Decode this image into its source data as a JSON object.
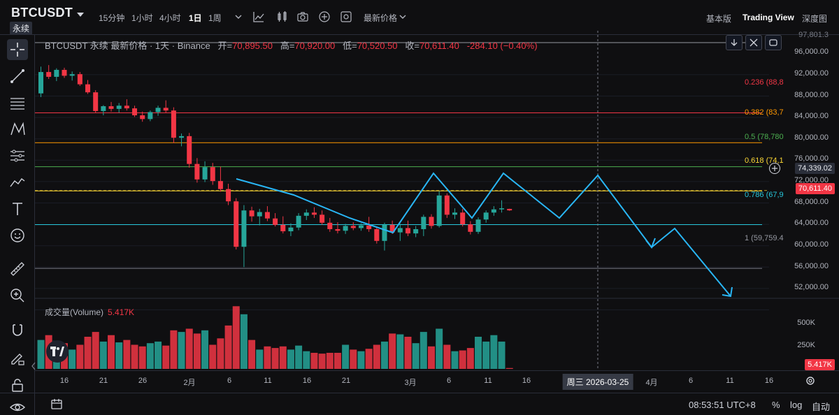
{
  "header": {
    "symbol": "BTCUSDT",
    "badge": "永续",
    "timeframes": [
      {
        "label": "15分钟",
        "active": false
      },
      {
        "label": "1小时",
        "active": false
      },
      {
        "label": "4小时",
        "active": false
      },
      {
        "label": "1日",
        "active": true
      },
      {
        "label": "1周",
        "active": false
      }
    ],
    "price_type": "最新价格",
    "views": [
      {
        "label": "基本版",
        "active": false
      },
      {
        "label": "Trading View",
        "active": true
      },
      {
        "label": "深度图",
        "active": false
      }
    ]
  },
  "legend": {
    "title": "BTCUSDT 永续 最新价格 · 1天 · Binance",
    "open_k": "开=",
    "open": "70,895.50",
    "high_k": "高=",
    "high": "70,920.00",
    "low_k": "低=",
    "low": "70,520.50",
    "close_k": "收=",
    "close": "70,611.40",
    "change": "-284.10 (−0.40%)"
  },
  "price_axis": {
    "top_partial": "97,801.3",
    "ticks": [
      "96,000.00",
      "92,000.00",
      "88,000.00",
      "84,000.00",
      "80,000.00",
      "76,000.00",
      "72,000.00",
      "68,000.00",
      "64,000.00",
      "60,000.00",
      "56,000.00",
      "52,000.00"
    ],
    "crosshair_price": "74,339.02",
    "last_price": "70,611.40"
  },
  "fib_levels": [
    {
      "label": "0.236 (88,8",
      "color": "#f23645"
    },
    {
      "label": "0.382 (83,7",
      "color": "#ff9800"
    },
    {
      "label": "0.5 (78,780",
      "color": "#4caf50"
    },
    {
      "label": "0.618 (74,1",
      "color": "#fdd835"
    },
    {
      "label": "0.786 (67,9",
      "color": "#26c6da"
    },
    {
      "label": "1 (59,759.4",
      "color": "#9598a1"
    }
  ],
  "volume": {
    "label": "成交量(Volume)",
    "value": "5.417K",
    "axis": [
      "500K",
      "250K"
    ],
    "last_tag": "5.417K"
  },
  "time_axis": {
    "ticks": [
      "16",
      "21",
      "26",
      "2月",
      "6",
      "11",
      "16",
      "21",
      "3月",
      "6",
      "11",
      "16",
      "4月",
      "6",
      "11",
      "16"
    ],
    "crosshair_date": "周三 2026-03-25"
  },
  "footer": {
    "clock": "08:53:51 UTC+8",
    "percent": "%",
    "log": "log",
    "auto": "自动"
  },
  "colors": {
    "up": "#26a69a",
    "down": "#f23645",
    "projection": "#29b6f6",
    "background": "#0f0f11"
  },
  "icons": [
    "crosshair-icon",
    "trend-line-icon",
    "horizontal-lines-icon",
    "pattern-icon",
    "fib-icon",
    "brush-icon",
    "text-icon",
    "emoji-icon",
    "ruler-icon",
    "zoom-in-icon",
    "magnet-icon",
    "lock-pencil-icon",
    "lock-icon",
    "eye-icon",
    "indicators-icon",
    "alert-icon",
    "camera-icon",
    "plus-circle-icon",
    "settings-icon",
    "download-icon",
    "expand-icon",
    "replay-icon",
    "calendar-range-icon"
  ]
}
